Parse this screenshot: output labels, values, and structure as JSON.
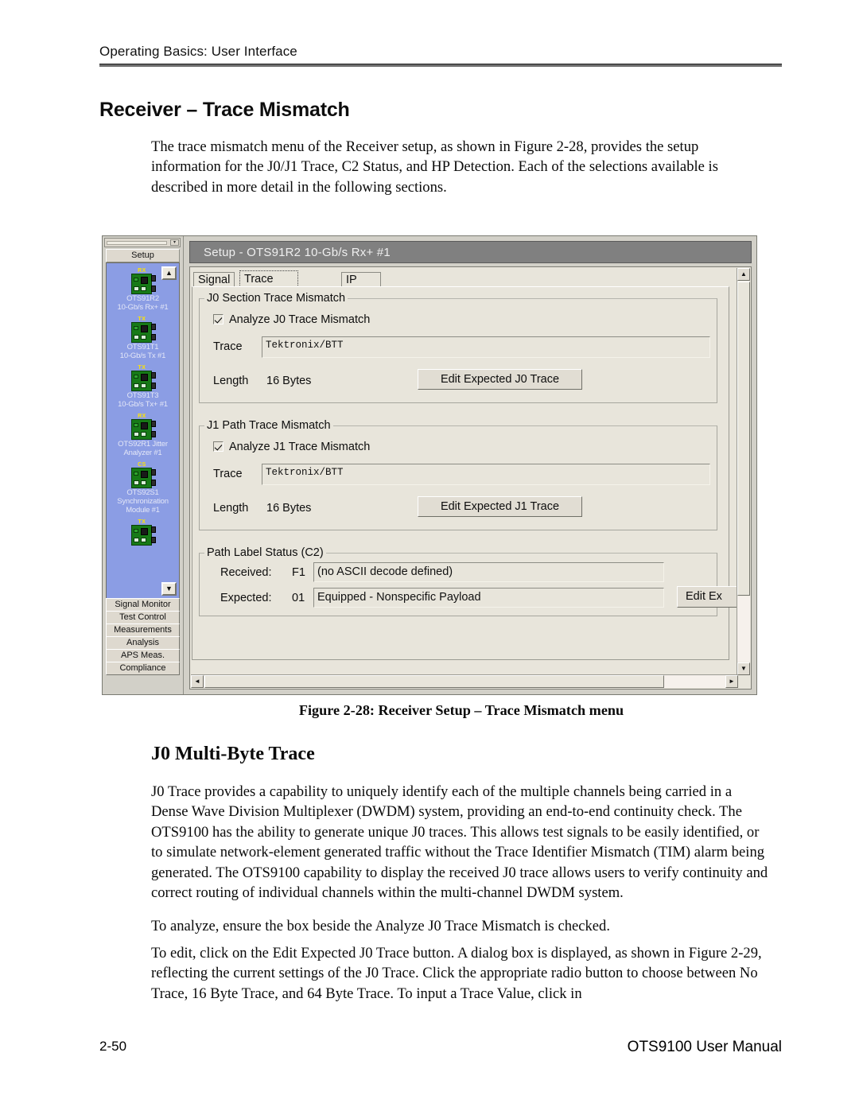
{
  "page": {
    "running_header": "Operating Basics: User Interface",
    "section_title": "Receiver – Trace Mismatch",
    "intro_paragraph": "The trace mismatch menu of the Receiver setup, as shown in Figure 2-28, provides the setup information for the J0/J1 Trace, C2 Status, and HP Detection.  Each of the selections available is described in more detail in the following sections.",
    "figure_caption": "Figure 2-28: Receiver Setup – Trace Mismatch menu",
    "sub_title": "J0 Multi-Byte Trace",
    "j0_paragraph": "J0 Trace provides a capability to uniquely identify each of the multiple channels being carried in a Dense Wave Division Multiplexer (DWDM) system, providing an end-to-end continuity check.  The OTS9100 has the ability to generate unique J0 traces.  This allows test signals to be easily identified, or to simulate network-element generated traffic without the Trace Identifier Mismatch (TIM) alarm being generated. The OTS9100 capability to display the received J0 trace allows users to verify continuity and correct routing of individual channels within the multi-channel DWDM system.",
    "analyze_paragraph": "To analyze, ensure the box beside the Analyze J0 Trace Mismatch is checked.",
    "edit_paragraph": "To edit, click on the Edit Expected J0 Trace button.  A dialog box is displayed, as shown in Figure 2-29, reflecting the current settings of the J0 Trace.  Click the appropriate radio button to choose between No Trace, 16 Byte Trace, and 64 Byte Trace.  To input a Trace Value, click in",
    "footer_page": "2-50",
    "footer_manual": "OTS9100 User Manual"
  },
  "screenshot": {
    "navigator": {
      "scroll_box_button": "▾",
      "setup_tab_label": "Setup",
      "scroll_up_glyph": "▲",
      "scroll_down_glyph": "▼",
      "modules": [
        {
          "tag": "RX",
          "line1": "OTS91R2",
          "line2": "10-Gb/s Rx+ #1"
        },
        {
          "tag": "TX",
          "line1": "OTS91T1",
          "line2": "10-Gb/s Tx #1"
        },
        {
          "tag": "TX",
          "line1": "OTS91T3",
          "line2": "10-Gb/s Tx+ #1"
        },
        {
          "tag": "RX",
          "line1": "OTS92R1 Jitter",
          "line2": "Analyzer #1"
        },
        {
          "tag": "CS",
          "line1": "OTS92S1",
          "line2": "Synchronization Module #1"
        },
        {
          "tag": "TX",
          "line1": "",
          "line2": ""
        }
      ],
      "buttons": [
        "Signal Monitor",
        "Test Control",
        "Measurements",
        "Analysis",
        "APS Meas.",
        "Compliance"
      ]
    },
    "window": {
      "title": "Setup - OTS91R2 10-Gb/s Rx+ #1",
      "tabs": [
        {
          "label": "Signal",
          "active": false
        },
        {
          "label": "Trace Mismatch",
          "active": true
        },
        {
          "label": "IP Setup",
          "active": false
        }
      ],
      "j0_group": {
        "title": "J0 Section Trace Mismatch",
        "checkbox_label": "Analyze J0 Trace Mismatch",
        "checkbox_checked": true,
        "trace_label": "Trace",
        "trace_value": "Tektronix/BTT",
        "length_label": "Length",
        "length_value": "16 Bytes",
        "edit_button": "Edit Expected J0 Trace"
      },
      "j1_group": {
        "title": "J1 Path Trace Mismatch",
        "checkbox_label": "Analyze J1 Trace Mismatch",
        "checkbox_checked": true,
        "trace_label": "Trace",
        "trace_value": "Tektronix/BTT",
        "length_label": "Length",
        "length_value": "16 Bytes",
        "edit_button": "Edit Expected J1 Trace"
      },
      "c2_group": {
        "title": "Path Label Status (C2)",
        "received_label": "Received:",
        "received_code": "F1",
        "received_value": "(no ASCII decode defined)",
        "expected_label": "Expected:",
        "expected_code": "01",
        "expected_value": "Equipped - Nonspecific Payload",
        "edit_button": "Edit Ex"
      },
      "scroll": {
        "up_glyph": "▲",
        "down_glyph": "▼",
        "left_glyph": "◄",
        "right_glyph": "►"
      }
    }
  },
  "colors": {
    "titlebar": "#808080",
    "module_list_blue": "#8b9de4",
    "dialog_face": "#e8e5db",
    "module_green": "#177a17",
    "module_tag_yellow": "#ffe400"
  }
}
